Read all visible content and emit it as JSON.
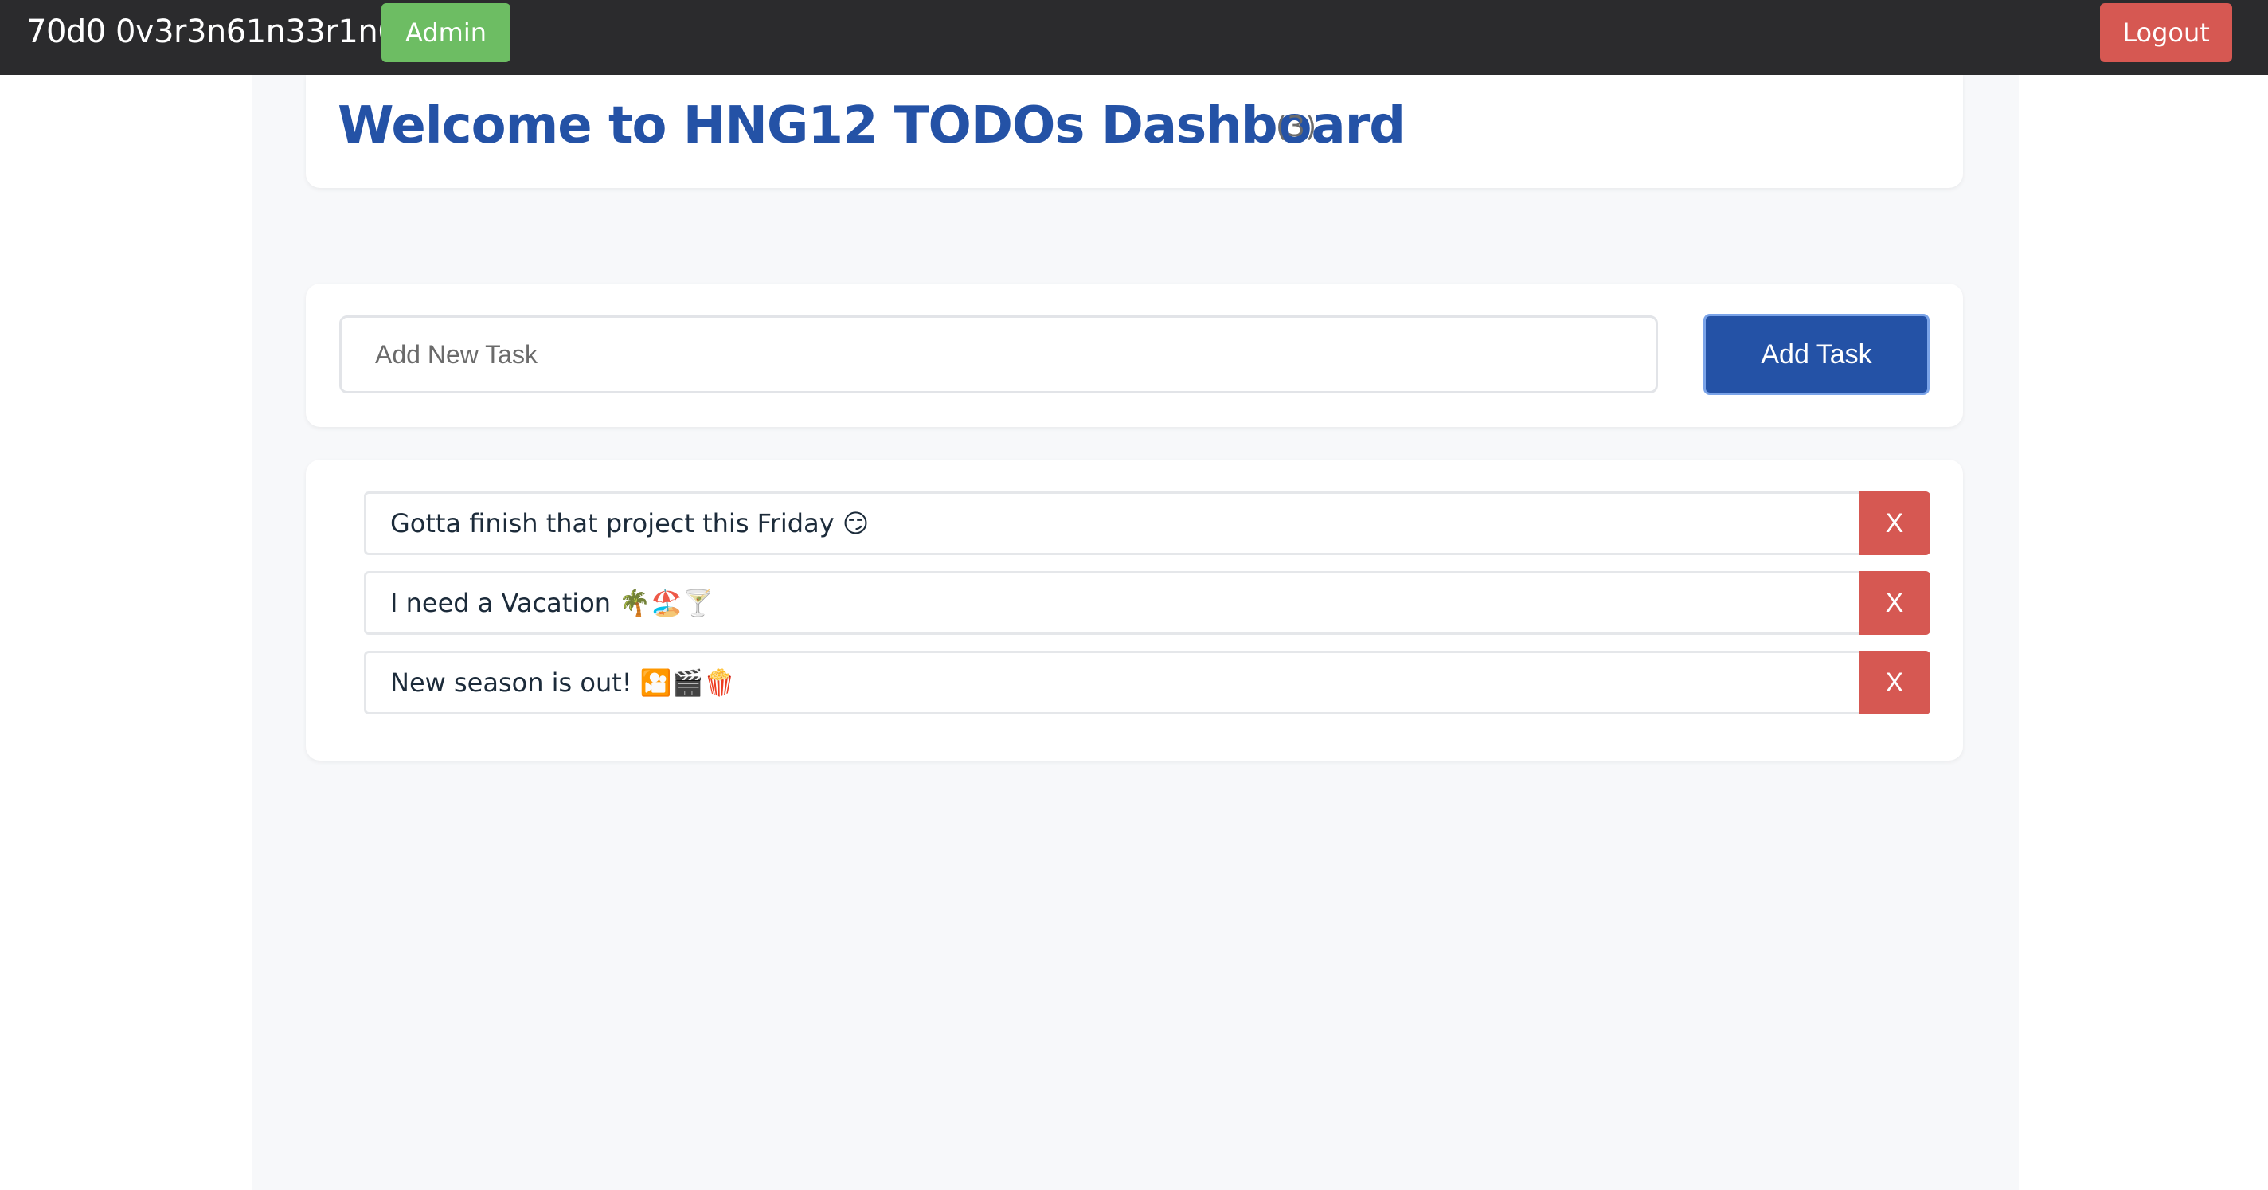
{
  "navbar": {
    "brand": "70d0 0v3r3n61n33r1n6",
    "admin_label": "Admin",
    "logout_label": "Logout"
  },
  "header": {
    "title": "Welcome to HNG12 TODOs Dashboard",
    "count": "(3)"
  },
  "form": {
    "input_placeholder": "Add New Task",
    "input_value": "",
    "add_label": "Add Task"
  },
  "tasks": [
    {
      "text": "Gotta finish that project this Friday 😏",
      "delete_label": "X"
    },
    {
      "text": "I need a Vacation 🌴🏖️🍸",
      "delete_label": "X"
    },
    {
      "text": "New season is out! 🎦🎬🍿",
      "delete_label": "X"
    }
  ],
  "colors": {
    "navbar_bg": "#2b2b2d",
    "admin_green": "#6dbd63",
    "danger_red": "#d65852",
    "primary_blue": "#2452a6"
  }
}
